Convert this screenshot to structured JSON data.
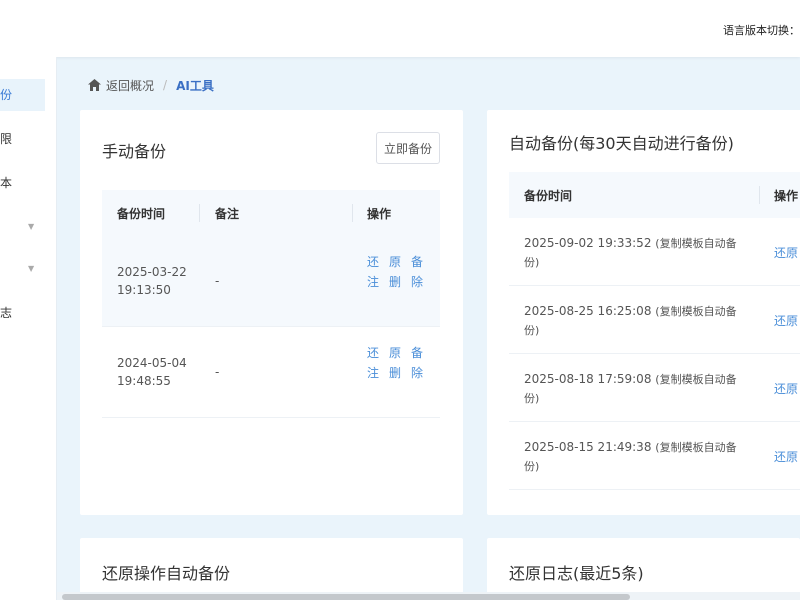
{
  "header": {
    "lang_switch_label": "语言版本切换："
  },
  "sidebar": {
    "items": [
      {
        "label": "份",
        "active": true
      },
      {
        "label": "限"
      },
      {
        "label": "本"
      },
      {
        "label": "",
        "has_caret": true
      },
      {
        "label": "",
        "has_caret": true
      },
      {
        "label": "志"
      }
    ]
  },
  "breadcrumb": {
    "back_label": "返回概况",
    "separator": "/",
    "current": "AI工具"
  },
  "manual_backup": {
    "title": "手动备份",
    "backup_now_label": "立即备份",
    "columns": [
      "备份时间",
      "备注",
      "操作"
    ],
    "rows": [
      {
        "time": "2025-03-22 19:13:50",
        "remark": "-",
        "actions": [
          "还原",
          "备注",
          "删除"
        ]
      },
      {
        "time": "2024-05-04 19:48:55",
        "remark": "-",
        "actions": [
          "还原",
          "备注",
          "删除"
        ]
      }
    ]
  },
  "auto_backup": {
    "title": "自动备份(每30天自动进行备份)",
    "columns": [
      "备份时间",
      "操作"
    ],
    "rows": [
      {
        "time": "2025-09-02 19:33:52",
        "remark": "(复制模板自动备份)",
        "action": "还原"
      },
      {
        "time": "2025-08-25 16:25:08",
        "remark": "(复制模板自动备份)",
        "action": "还原"
      },
      {
        "time": "2025-08-18 17:59:08",
        "remark": "(复制模板自动备份)",
        "action": "还原"
      },
      {
        "time": "2025-08-15 21:49:38",
        "remark": "(复制模板自动备份)",
        "action": "还原"
      }
    ]
  },
  "restore_auto_backup": {
    "title": "还原操作自动备份"
  },
  "restore_log": {
    "title": "还原日志(最近5条)"
  },
  "colors": {
    "accent": "#4a8ed8",
    "page_bg": "#eaf4fb",
    "table_head_bg": "#f5f9fd"
  }
}
